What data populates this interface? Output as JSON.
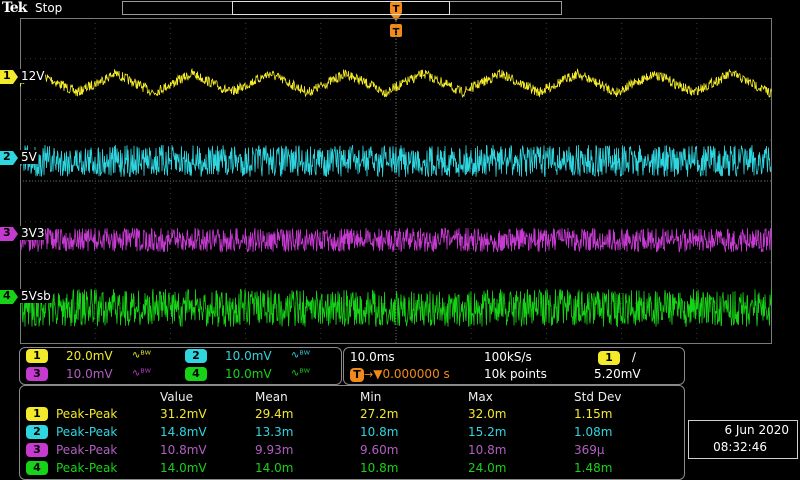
{
  "header": {
    "logo": "Tek",
    "status": "Stop"
  },
  "trigger": {
    "position_marker": "T",
    "time_marker": "T"
  },
  "channels": [
    {
      "num": "1",
      "label": "12V",
      "color": "#f2ea2a",
      "scale": "20.0mV",
      "bw": "∿ᴮᵂ"
    },
    {
      "num": "2",
      "label": "5V",
      "color": "#2fd6e0",
      "scale": "10.0mV",
      "bw": "∿ᴮᵂ"
    },
    {
      "num": "3",
      "label": "3V3",
      "color": "#c53bd0",
      "scale": "10.0mV",
      "bw": "∿ᴮᵂ"
    },
    {
      "num": "4",
      "label": "5Vsb",
      "color": "#17d317",
      "scale": "10.0mV",
      "bw": "∿ᴮᵂ"
    }
  ],
  "horizontal": {
    "timebase": "10.0ms",
    "sample_rate": "100kS/s",
    "trigger_delay_icon": "T",
    "trigger_delay": "▼0.000000 s",
    "record_length": "10k points",
    "trigger_source": "1",
    "trigger_slope": "∕",
    "trigger_level": "5.20mV"
  },
  "measurements": {
    "headers": [
      "Value",
      "Mean",
      "Min",
      "Max",
      "Std Dev"
    ],
    "rows": [
      {
        "ch": "1",
        "type": "Peak-Peak",
        "value": "31.2mV",
        "mean": "29.4m",
        "min": "27.2m",
        "max": "32.0m",
        "std": "1.15m",
        "color": "#f2ea2a"
      },
      {
        "ch": "2",
        "type": "Peak-Peak",
        "value": "14.8mV",
        "mean": "13.3m",
        "min": "10.8m",
        "max": "15.2m",
        "std": "1.08m",
        "color": "#2fd6e0"
      },
      {
        "ch": "3",
        "type": "Peak-Peak",
        "value": "10.8mV",
        "mean": "9.93m",
        "min": "9.60m",
        "max": "10.8m",
        "std": "369μ",
        "color": "#c53bd0"
      },
      {
        "ch": "4",
        "type": "Peak-Peak",
        "value": "14.0mV",
        "mean": "14.0m",
        "min": "10.8m",
        "max": "24.0m",
        "std": "1.48m",
        "color": "#17d317"
      }
    ]
  },
  "datetime": {
    "date": "6 Jun  2020",
    "time": "08:32:46"
  }
}
